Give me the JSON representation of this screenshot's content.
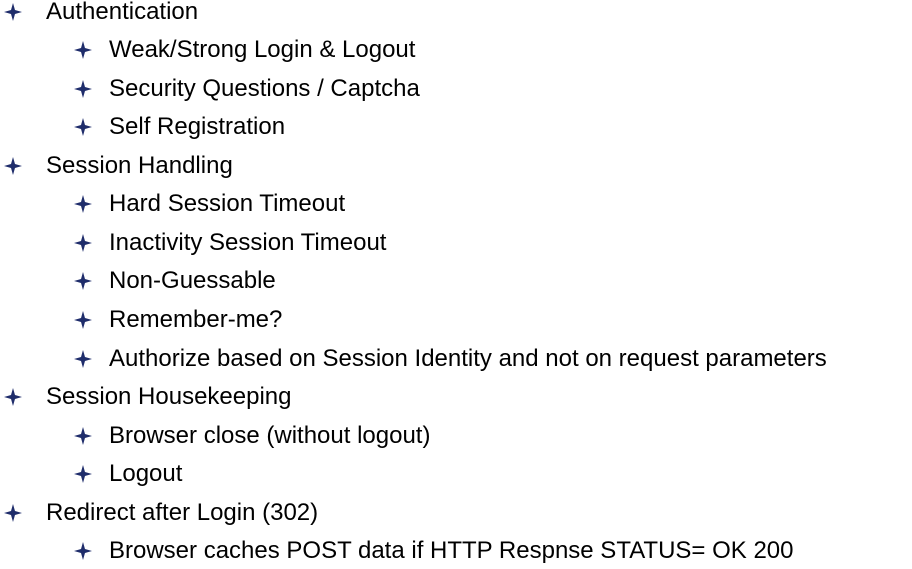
{
  "outline": {
    "bullet_icon": "four-point-star-icon",
    "bullet_color": "#1f2d6b",
    "items": [
      {
        "level": 1,
        "text": "Authentication"
      },
      {
        "level": 2,
        "text": "Weak/Strong Login & Logout"
      },
      {
        "level": 2,
        "text": "Security Questions / Captcha"
      },
      {
        "level": 2,
        "text": "Self Registration"
      },
      {
        "level": 1,
        "text": "Session Handling"
      },
      {
        "level": 2,
        "text": "Hard Session Timeout"
      },
      {
        "level": 2,
        "text": "Inactivity Session Timeout"
      },
      {
        "level": 2,
        "text": "Non-Guessable"
      },
      {
        "level": 2,
        "text": "Remember-me?"
      },
      {
        "level": 2,
        "text": "Authorize based on Session Identity and not on request parameters"
      },
      {
        "level": 1,
        "text": "Session Housekeeping"
      },
      {
        "level": 2,
        "text": "Browser close (without logout)"
      },
      {
        "level": 2,
        "text": "Logout"
      },
      {
        "level": 1,
        "text": "Redirect after Login (302)"
      },
      {
        "level": 2,
        "text": "Browser caches POST data if HTTP Respnse STATUS= OK 200"
      }
    ]
  }
}
